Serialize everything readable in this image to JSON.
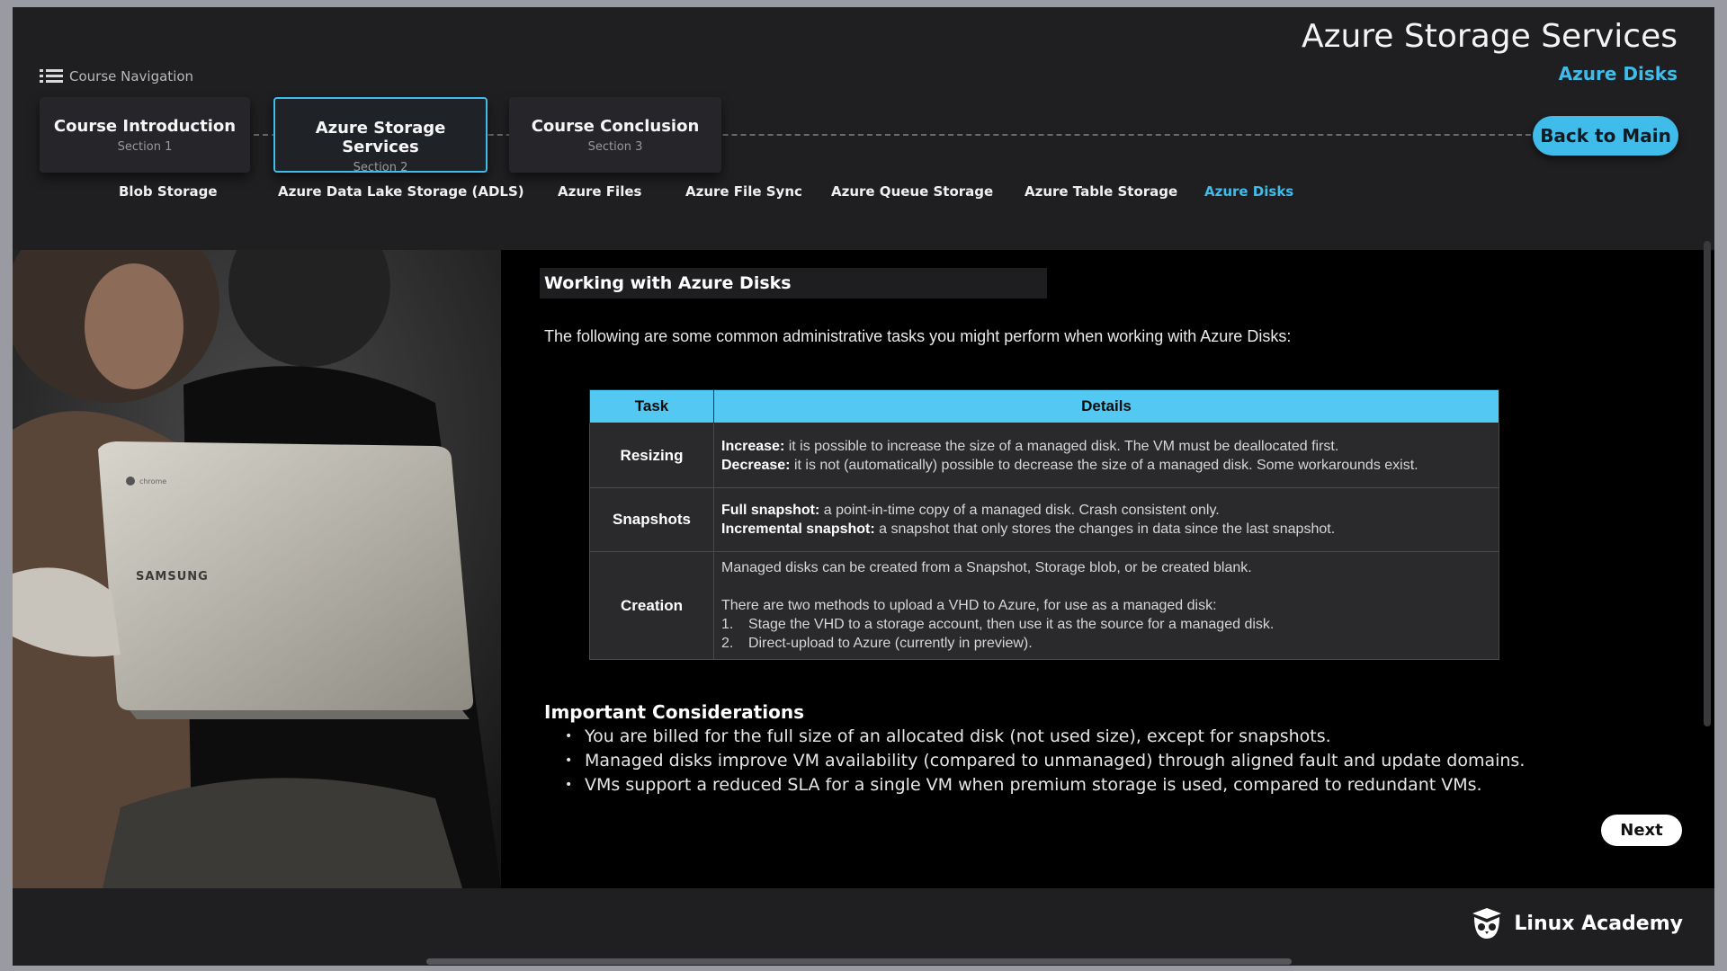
{
  "header": {
    "title": "Azure Storage Services",
    "subtitle": "Azure Disks"
  },
  "nav": {
    "label": "Course Navigation",
    "icon": "list-icon"
  },
  "sections": [
    {
      "title": "Course Introduction",
      "subtitle": "Section 1",
      "active": false
    },
    {
      "title": "Azure Storage Services",
      "subtitle": "Section 2",
      "active": true
    },
    {
      "title": "Course Conclusion",
      "subtitle": "Section 3",
      "active": false
    }
  ],
  "back_button": "Back to Main",
  "topics": [
    "Blob Storage",
    "Azure Data Lake Storage (ADLS)",
    "Azure Files",
    "Azure File Sync",
    "Azure Queue Storage",
    "Azure Table Storage",
    "Azure Disks"
  ],
  "active_topic": "Azure Disks",
  "main": {
    "heading": "Working with Azure Disks",
    "intro": "The following are some common administrative tasks you might perform when working with Azure Disks:",
    "table": {
      "headers": [
        "Task",
        "Details"
      ],
      "rows": [
        {
          "task": "Resizing",
          "lines": [
            {
              "label": "Increase:",
              "text": " it is possible to increase the size of a managed disk. The VM must be deallocated first."
            },
            {
              "label": "Decrease:",
              "text": " it is not (automatically) possible to decrease the size of a managed disk. Some workarounds exist."
            }
          ]
        },
        {
          "task": "Snapshots",
          "lines": [
            {
              "label": "Full snapshot:",
              "text": " a point-in-time copy of a managed disk. Crash consistent only."
            },
            {
              "label": "Incremental snapshot:",
              "text": " a snapshot that only stores the changes in data since the last snapshot."
            }
          ]
        },
        {
          "task": "Creation",
          "para1": "Managed disks can be created from a Snapshot, Storage blob, or be created blank.",
          "para2": "There are two methods to upload a VHD to Azure, for use as a managed disk:",
          "items": [
            {
              "n": "1.",
              "text": "Stage the VHD to a storage account, then use it as the source for a managed disk."
            },
            {
              "n": "2.",
              "text": "Direct-upload to Azure (currently in preview)."
            }
          ]
        }
      ]
    },
    "considerations_title": "Important Considerations",
    "considerations": [
      "You are billed for the full size of an allocated disk (not used size), except for snapshots.",
      "Managed disks improve VM availability (compared to unmanaged) through aligned fault and update domains.",
      "VMs support a reduced SLA for a single VM when premium storage is used, compared to redundant VMs."
    ]
  },
  "next_button": "Next",
  "photo": {
    "laptop_brand": "SAMSUNG",
    "laptop_logo": "chrome"
  },
  "brand": {
    "name": "Linux Academy",
    "icon": "owl-logo-icon"
  },
  "colors": {
    "accent": "#3fbce9",
    "table_header": "#52c8f3",
    "background": "#1f1f21"
  }
}
